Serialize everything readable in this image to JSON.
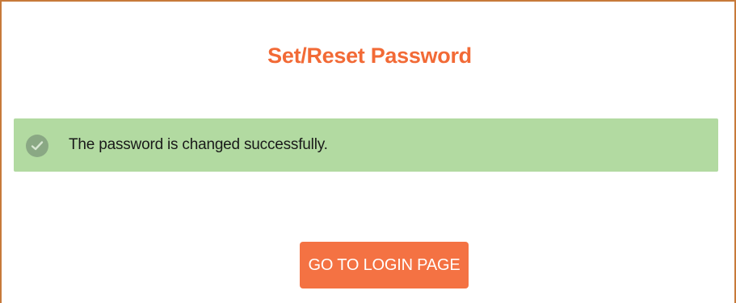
{
  "page": {
    "title": "Set/Reset Password"
  },
  "alert": {
    "icon": "check-circle-icon",
    "message": "The password is changed successfully."
  },
  "actions": {
    "login_button_label": "GO TO LOGIN PAGE"
  },
  "colors": {
    "accent": "#f26a36",
    "button": "#f47243",
    "success_background": "#b2daa1",
    "success_icon": "#8aa884",
    "frame_border": "#c77a3a"
  }
}
